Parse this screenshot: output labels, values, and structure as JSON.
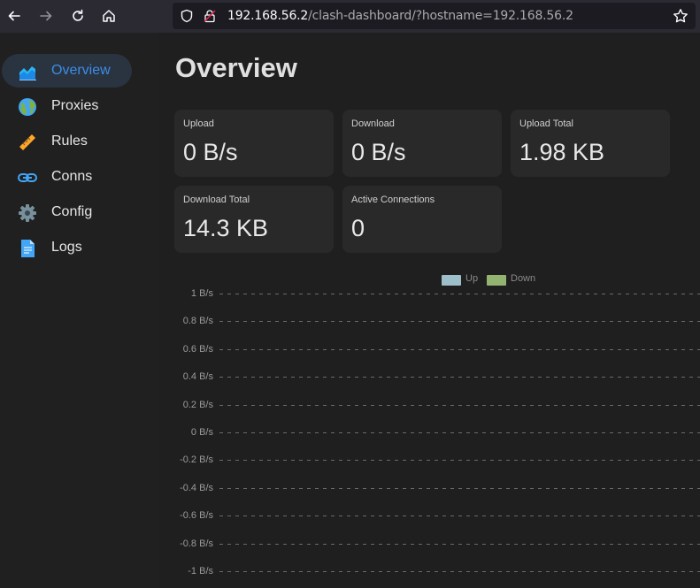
{
  "browser": {
    "url_host": "192.168.56.2",
    "url_path": "/clash-dashboard/?hostname=192.168.56.2"
  },
  "sidebar": {
    "items": [
      {
        "label": "Overview",
        "icon": "area-chart-icon",
        "active": true
      },
      {
        "label": "Proxies",
        "icon": "globe-icon"
      },
      {
        "label": "Rules",
        "icon": "ruler-icon"
      },
      {
        "label": "Conns",
        "icon": "link-icon"
      },
      {
        "label": "Config",
        "icon": "gear-icon"
      },
      {
        "label": "Logs",
        "icon": "document-icon"
      }
    ]
  },
  "main": {
    "title": "Overview",
    "cards": [
      {
        "label": "Upload",
        "value": "0 B/s"
      },
      {
        "label": "Download",
        "value": "0 B/s"
      },
      {
        "label": "Upload Total",
        "value": "1.98 KB"
      },
      {
        "label": "Download Total",
        "value": "14.3 KB"
      },
      {
        "label": "Active Connections",
        "value": "0"
      }
    ]
  },
  "chart_data": {
    "type": "line",
    "series": [
      {
        "name": "Up",
        "color": "#9dbfc9",
        "values": []
      },
      {
        "name": "Down",
        "color": "#93b371",
        "values": []
      }
    ],
    "y_ticks": [
      "1 B/s",
      "0.8 B/s",
      "0.6 B/s",
      "0.4 B/s",
      "0.2 B/s",
      "0 B/s",
      "-0.2 B/s",
      "-0.4 B/s",
      "-0.6 B/s",
      "-0.8 B/s",
      "-1 B/s"
    ],
    "ylim": [
      -1,
      1
    ],
    "grid": true,
    "legend_position": "top-center"
  }
}
